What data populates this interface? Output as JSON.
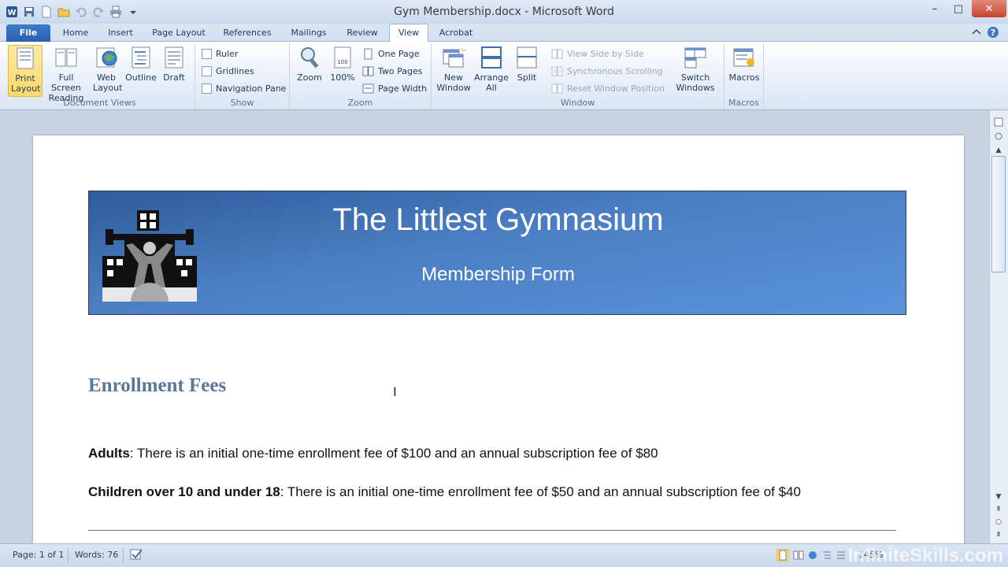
{
  "window": {
    "title": "Gym Membership.docx - Microsoft Word",
    "app_icon": "W",
    "min_label": "–",
    "max_label": "□",
    "close_label": "✕"
  },
  "tabs": [
    "File",
    "Home",
    "Insert",
    "Page Layout",
    "References",
    "Mailings",
    "Review",
    "View",
    "Acrobat"
  ],
  "active_tab": "View",
  "ribbon": {
    "document_views": {
      "label": "Document Views",
      "print_layout": "Print Layout",
      "full_screen_reading": "Full Screen Reading",
      "web_layout": "Web Layout",
      "outline": "Outline",
      "draft": "Draft"
    },
    "show": {
      "label": "Show",
      "ruler": "Ruler",
      "gridlines": "Gridlines",
      "navigation_pane": "Navigation Pane"
    },
    "zoom": {
      "label": "Zoom",
      "zoom": "Zoom",
      "hundred": "100%",
      "one_page": "One Page",
      "two_pages": "Two Pages",
      "page_width": "Page Width"
    },
    "window": {
      "label": "Window",
      "new_window": "New Window",
      "arrange_all": "Arrange All",
      "split": "Split",
      "view_side_by_side": "View Side by Side",
      "synchronous_scrolling": "Synchronous Scrolling",
      "reset_window_position": "Reset Window Position",
      "switch_windows": "Switch Windows"
    },
    "macros": {
      "label": "Macros",
      "macros": "Macros"
    }
  },
  "document": {
    "banner_title": "The Littlest Gymnasium",
    "banner_subtitle": "Membership Form",
    "heading": "Enrollment Fees",
    "para1_bold": "Adults",
    "para1_text": ": There is an initial one-time enrollment fee of $100 and an annual subscription fee of $80",
    "para2_bold": "Children over 10 and under 18",
    "para2_text": ": There is an initial one-time enrollment fee of $50 and an annual subscription fee of $40"
  },
  "statusbar": {
    "page": "Page: 1 of 1",
    "words": "Words: 76",
    "zoom": "145%",
    "watermark": "InfiniteSkills.com"
  },
  "colors": {
    "accent": "#2a5fb0",
    "heading": "#5b7797",
    "banner": "#4c7fc4"
  }
}
